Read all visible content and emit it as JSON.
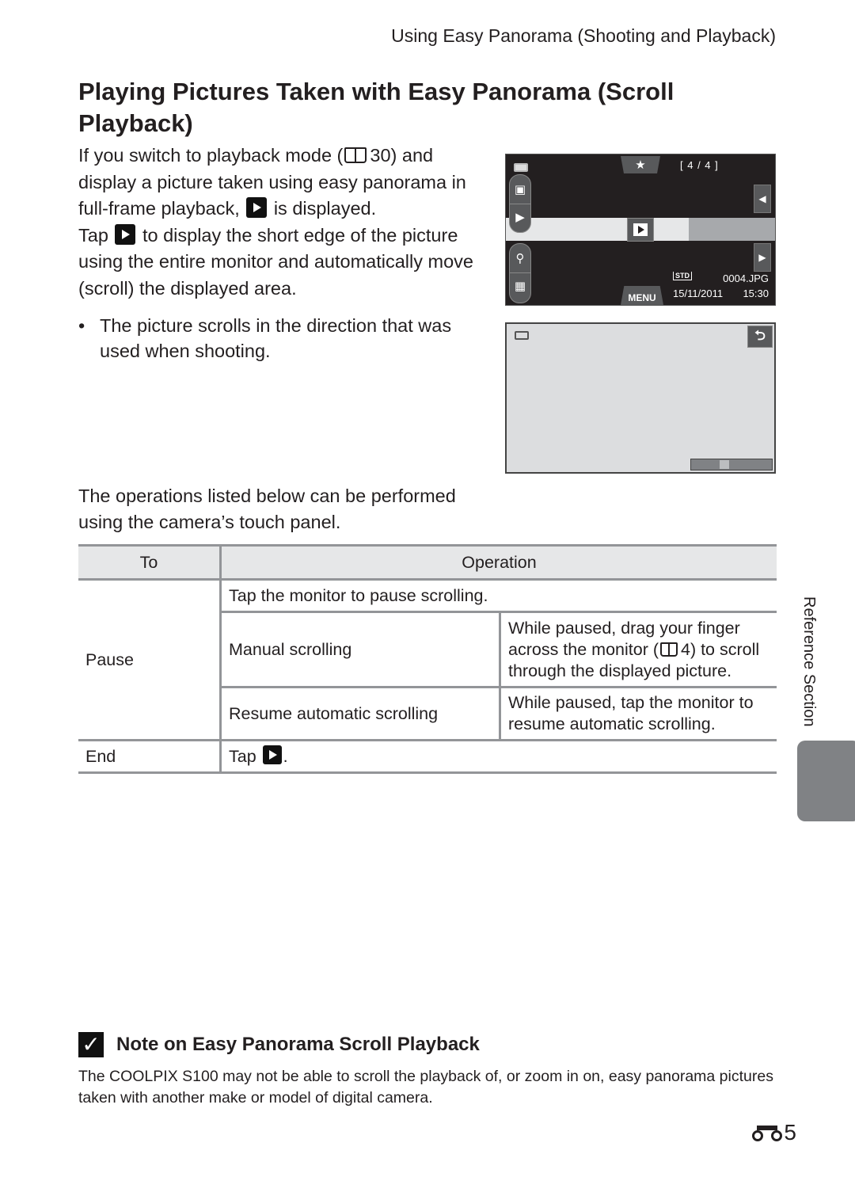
{
  "running_head": "Using Easy Panorama (Shooting and Playback)",
  "title": "Playing Pictures Taken with Easy Panorama (Scroll Playback)",
  "intro": {
    "p1_a": "If you switch to playback mode (",
    "p1_ref": "30",
    "p1_b": ") and display a picture taken using easy panorama in full-frame playback,",
    "p1_c": "is displayed.",
    "p2_a": "Tap",
    "p2_b": "to display the short edge of the picture using the entire monitor and automatically move (scroll) the displayed area."
  },
  "bullet": "The picture scrolls in the direction that was used when shooting.",
  "screen1": {
    "favorite_icon": "star-icon",
    "favorite_glyph": "★",
    "frame_counter": "[   4 /   4 ]",
    "prev_glyph": "◀",
    "next_glyph": "▶",
    "menu_label": "MENU",
    "quality": "STD",
    "filename": "0004.JPG",
    "date": "15/11/2011",
    "time": "15:30",
    "side_top": [
      "camera-icon",
      "playback-icon"
    ],
    "side_bottom": [
      "zoom-icon",
      "thumbnail-icon"
    ]
  },
  "screen2": {
    "back_glyph": "⮌",
    "scroll_position": 0.4
  },
  "ops_intro": "The operations listed below can be performed using the camera’s touch panel.",
  "table": {
    "headers": [
      "To",
      "Operation"
    ],
    "pause_label": "Pause",
    "pause_row1": "Tap the monitor to pause scrolling.",
    "manual_label": "Manual scrolling",
    "manual_desc_a": "While paused, drag your finger across the monitor (",
    "manual_ref": "4",
    "manual_desc_b": ") to scroll through the displayed picture.",
    "resume_label": "Resume automatic scrolling",
    "resume_desc": "While paused, tap the monitor to resume automatic scrolling.",
    "end_label": "End",
    "end_desc_a": "Tap",
    "end_desc_b": "."
  },
  "side_label": "Reference Section",
  "note": {
    "heading": "Note on Easy Panorama Scroll Playback",
    "body": "The COOLPIX S100 may not be able to scroll the playback of, or zoom in on, easy panorama pictures taken with another make or model of digital camera."
  },
  "page_number": "5"
}
